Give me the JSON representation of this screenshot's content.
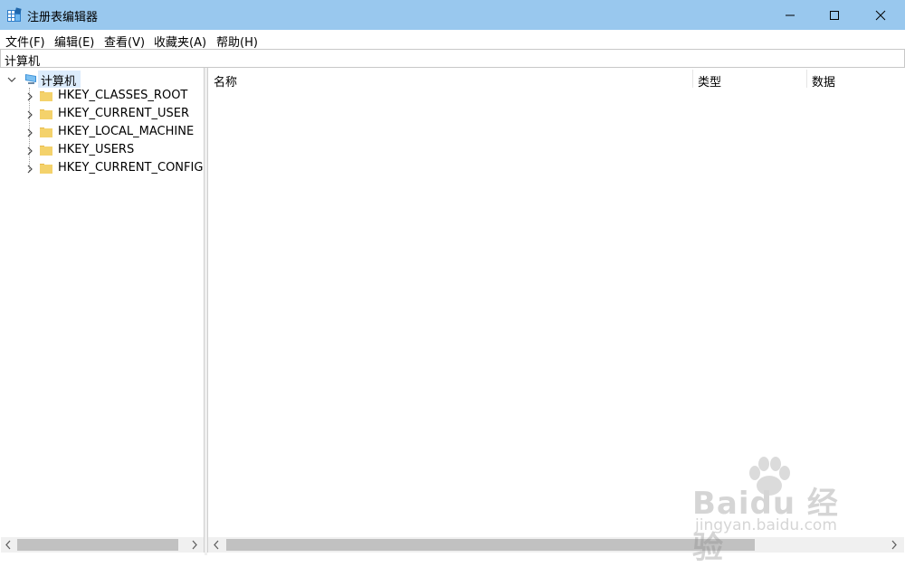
{
  "window": {
    "title": "注册表编辑器",
    "icon": "regedit-icon",
    "controls": [
      "minimize",
      "maximize",
      "close"
    ]
  },
  "menu": [
    {
      "label": "文件(F)"
    },
    {
      "label": "编辑(E)"
    },
    {
      "label": "查看(V)"
    },
    {
      "label": "收藏夹(A)"
    },
    {
      "label": "帮助(H)"
    }
  ],
  "address": {
    "path": "计算机"
  },
  "tree": {
    "root": {
      "label": "计算机",
      "icon": "computer-icon",
      "expanded": true,
      "selected": true
    },
    "children": [
      {
        "label": "HKEY_CLASSES_ROOT",
        "icon": "folder-icon"
      },
      {
        "label": "HKEY_CURRENT_USER",
        "icon": "folder-icon"
      },
      {
        "label": "HKEY_LOCAL_MACHINE",
        "icon": "folder-icon"
      },
      {
        "label": "HKEY_USERS",
        "icon": "folder-icon"
      },
      {
        "label": "HKEY_CURRENT_CONFIG",
        "icon": "folder-icon"
      }
    ]
  },
  "list": {
    "columns": [
      {
        "label": "名称"
      },
      {
        "label": "类型"
      },
      {
        "label": "数据"
      }
    ]
  },
  "watermark": {
    "brand": "Baidu 经验",
    "url": "jingyan.baidu.com"
  },
  "colors": {
    "titlebar": "#99c8ee",
    "selection": "#dcecfc",
    "folder": "#f4d26b"
  }
}
